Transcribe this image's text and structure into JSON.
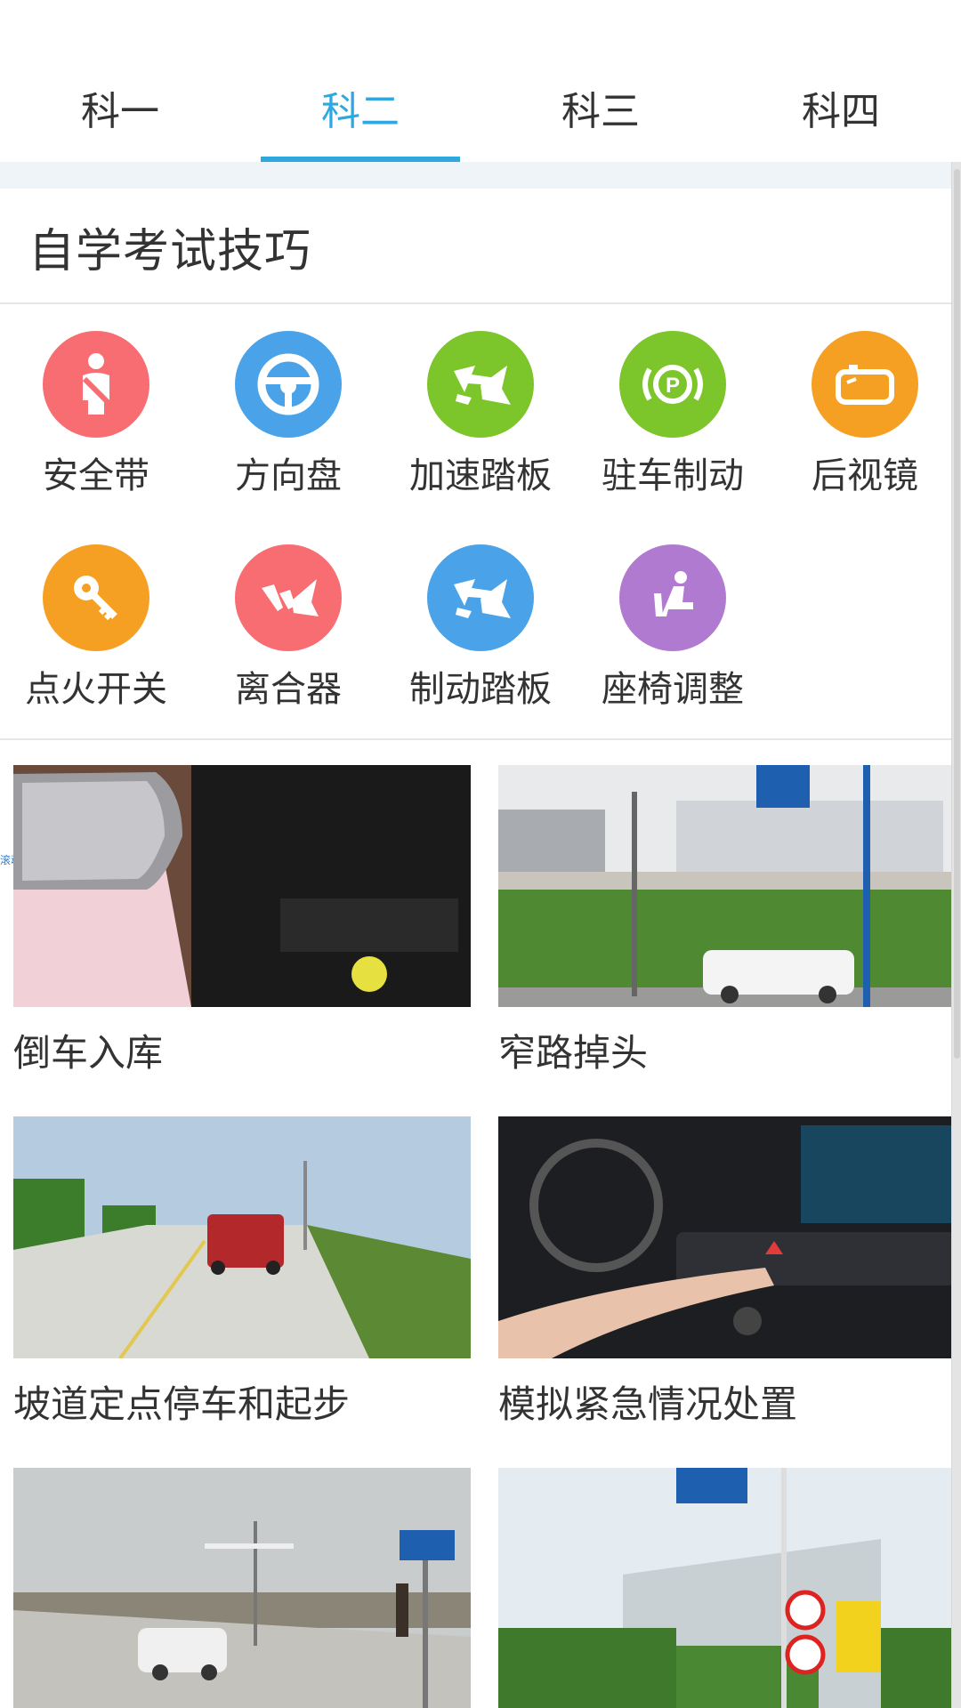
{
  "tabs": [
    {
      "label": "科一",
      "active": false
    },
    {
      "label": "科二",
      "active": true
    },
    {
      "label": "科三",
      "active": false
    },
    {
      "label": "科四",
      "active": false
    }
  ],
  "colors": {
    "accent": "#2ea8df",
    "pink": "#f76d72",
    "blue": "#4aa3e8",
    "green": "#7cc52a",
    "orange": "#f5a022",
    "purple": "#b07ad0"
  },
  "section": {
    "title": "自学考试技巧"
  },
  "icons": [
    {
      "label": "安全带",
      "icon": "seatbelt-icon",
      "color": "#f76d72"
    },
    {
      "label": "方向盘",
      "icon": "steering-wheel-icon",
      "color": "#4aa3e8"
    },
    {
      "label": "加速踏板",
      "icon": "accelerator-pedal-icon",
      "color": "#7cc52a"
    },
    {
      "label": "驻车制动",
      "icon": "parking-brake-icon",
      "color": "#7cc52a"
    },
    {
      "label": "后视镜",
      "icon": "rearview-mirror-icon",
      "color": "#f5a022"
    },
    {
      "label": "点火开关",
      "icon": "ignition-key-icon",
      "color": "#f5a022"
    },
    {
      "label": "离合器",
      "icon": "clutch-pedal-icon",
      "color": "#f76d72"
    },
    {
      "label": "制动踏板",
      "icon": "brake-pedal-icon",
      "color": "#4aa3e8"
    },
    {
      "label": "座椅调整",
      "icon": "seat-adjust-icon",
      "color": "#b07ad0"
    }
  ],
  "tiny_overlay_text": "滚动文字",
  "cards": [
    {
      "title": "倒车入库",
      "image": "side-mirror-photo"
    },
    {
      "title": "窄路掉头",
      "image": "narrow-road-photo"
    },
    {
      "title": "坡道定点停车和起步",
      "image": "slope-parking-photo"
    },
    {
      "title": "模拟紧急情况处置",
      "image": "dashboard-hazard-button-photo"
    },
    {
      "title": "",
      "image": "side-parking-photo"
    },
    {
      "title": "",
      "image": "tunnel-sign-photo"
    }
  ]
}
